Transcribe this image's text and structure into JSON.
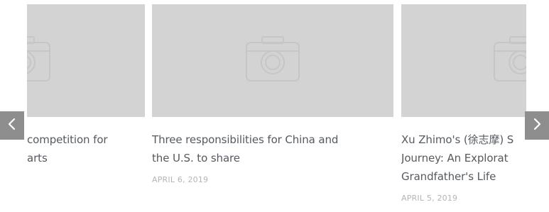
{
  "carousel": {
    "items": [
      {
        "title_lines": [
          "competition for",
          "arts"
        ],
        "date": ""
      },
      {
        "title_lines": [
          "Three responsibilities for China and",
          "the U.S. to share"
        ],
        "date": "APRIL 6, 2019"
      },
      {
        "title_lines": [
          "Xu Zhimo's (徐志摩) S",
          "Journey: An Explorat",
          "Grandfather's Life"
        ],
        "date": "APRIL 5, 2019"
      }
    ],
    "prev_icon": "chevron-left-icon",
    "next_icon": "chevron-right-icon"
  },
  "colors": {
    "placeholder": "#d3d3d3",
    "camera_outline": "#c6c6c6",
    "nav_button": "#8e8e8e",
    "title_text": "#555a60",
    "date_text": "#b5b5b5"
  }
}
